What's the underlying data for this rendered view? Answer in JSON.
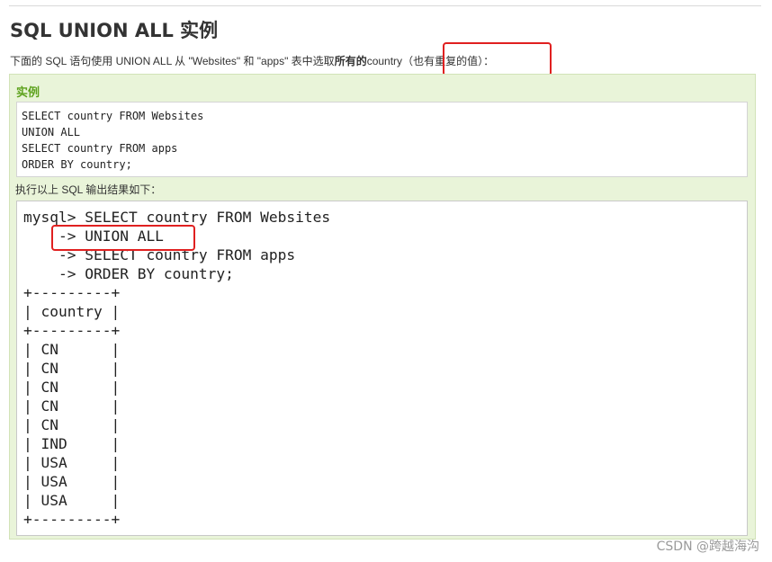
{
  "title": "SQL UNION ALL 实例",
  "intro": {
    "prefix": "下面的 SQL 语句使用 UNION ALL 从 \"Websites\" 和 \"apps\" 表中选取",
    "bold": "所有的",
    "middle": "country",
    "highlight": "（也有重复的值）",
    "suffix": "："
  },
  "example": {
    "label": "实例",
    "code_lines": [
      "SELECT country FROM Websites",
      "UNION ALL",
      "SELECT country FROM apps",
      "ORDER BY country;"
    ]
  },
  "result": {
    "caption": "执行以上 SQL 输出结果如下：",
    "terminal_lines": [
      "mysql> SELECT country FROM Websites",
      "    -> UNION ALL",
      "    -> SELECT country FROM apps",
      "    -> ORDER BY country;",
      "+---------+",
      "| country |",
      "+---------+",
      "| CN      |",
      "| CN      |",
      "| CN      |",
      "| CN      |",
      "| CN      |",
      "| IND     |",
      "| USA     |",
      "| USA     |",
      "| USA     |",
      "+---------+"
    ]
  },
  "watermark": "CSDN @跨越海沟",
  "colors": {
    "accent_green": "#5ea21e",
    "panel_bg": "#e9f4d9",
    "highlight_red": "#e02020"
  }
}
